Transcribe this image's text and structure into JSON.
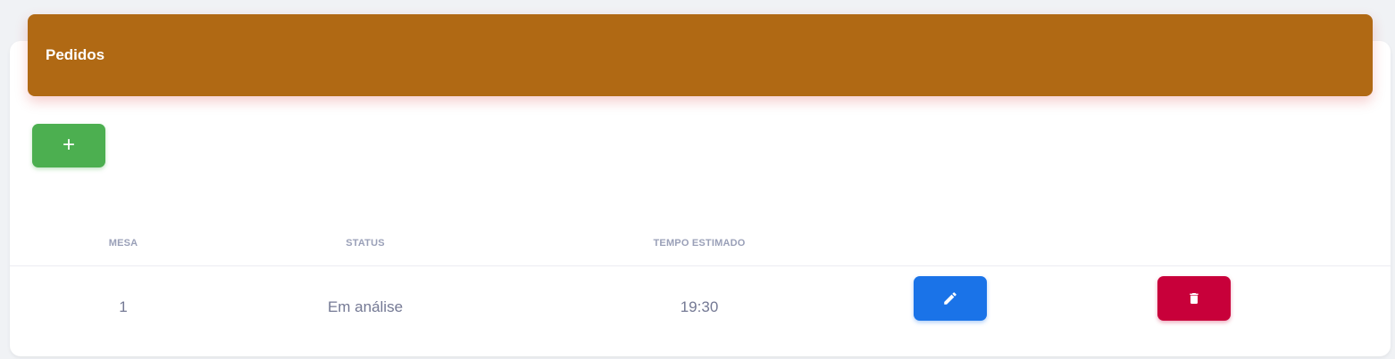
{
  "header": {
    "title": "Pedidos",
    "color": "#b06914"
  },
  "toolbar": {
    "add_label": "+",
    "add_color": "#4caf50"
  },
  "table": {
    "columns": [
      "MESA",
      "STATUS",
      "TEMPO ESTIMADO"
    ],
    "rows": [
      {
        "mesa": "1",
        "status": "Em análise",
        "tempo_estimado": "19:30",
        "edit_icon": "pencil-icon",
        "delete_icon": "trash-icon"
      }
    ]
  },
  "colors": {
    "edit": "#1a73e8",
    "delete": "#c8003a",
    "header_text": "#9aa0b8",
    "cell_text": "#747994"
  }
}
